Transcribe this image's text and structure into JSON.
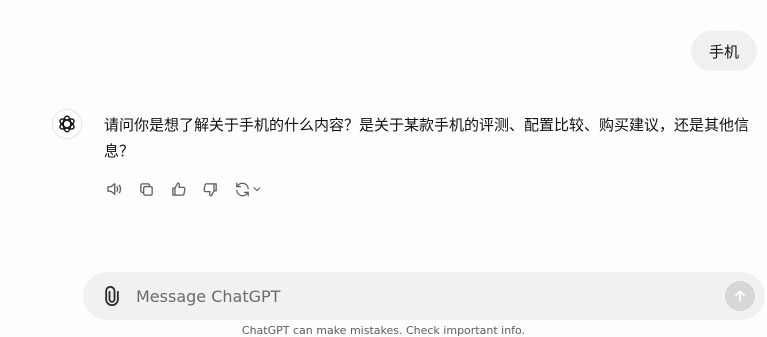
{
  "conversation": {
    "user_message": "手机",
    "assistant_message": "请问你是想了解关于手机的什么内容？是关于某款手机的评测、配置比较、购买建议，还是其他信息？"
  },
  "actions": {
    "read_aloud": "speaker-icon",
    "copy": "copy-icon",
    "good_response": "thumbs-up-icon",
    "bad_response": "thumbs-down-icon",
    "regenerate": "regenerate-icon"
  },
  "composer": {
    "placeholder": "Message ChatGPT"
  },
  "footer": {
    "note": "ChatGPT can make mistakes. Check important info."
  }
}
